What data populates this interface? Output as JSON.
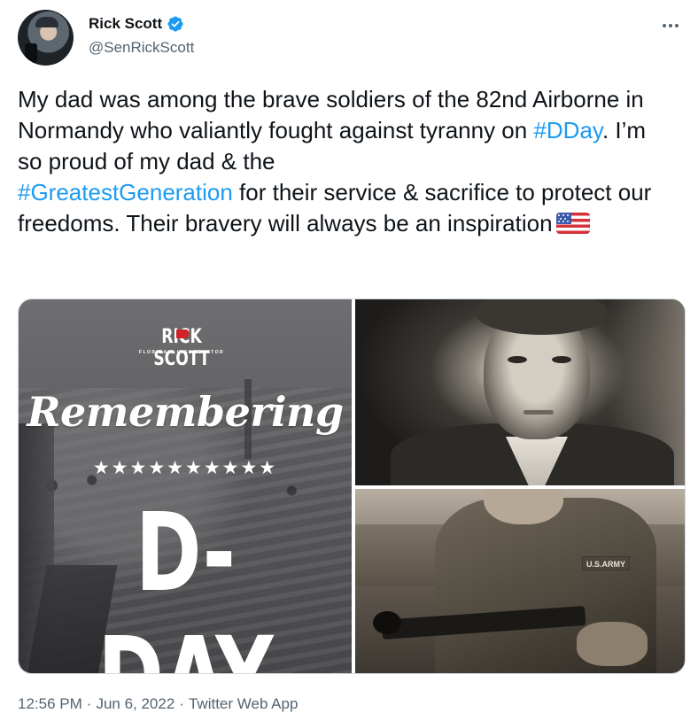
{
  "author": {
    "name": "Rick Scott",
    "handle": "@SenRickScott",
    "verified": true,
    "avatar_icon": "avatar-photo"
  },
  "tweet": {
    "text_parts": [
      "My dad was among the brave soldiers of the 82nd Airborne in Normandy who valiantly fought against tyranny on ",
      "#DDay",
      ". I’m so proud of my dad & the ",
      "#GreatestGeneration",
      " for their service & sacrifice to protect our freedoms. Their bravery will always be an inspiration"
    ],
    "emoji": "us-flag-icon"
  },
  "media": {
    "graphic": {
      "logo_title": "RICK SCOTT",
      "logo_subtitle": "FLORIDA’S U.S. SENATOR",
      "headline": "Remembering",
      "stars": "★★★★★★★★★★",
      "main_text": "D-DAY"
    },
    "photo_bottom_tag": "U.S.ARMY"
  },
  "meta": {
    "time": "12:56 PM",
    "separator": "·",
    "date": "Jun 6, 2022",
    "source": "Twitter Web App"
  },
  "colors": {
    "link": "#1d9bf0",
    "text": "#0f1419",
    "secondary": "#536471",
    "verified": "#1d9bf0"
  }
}
